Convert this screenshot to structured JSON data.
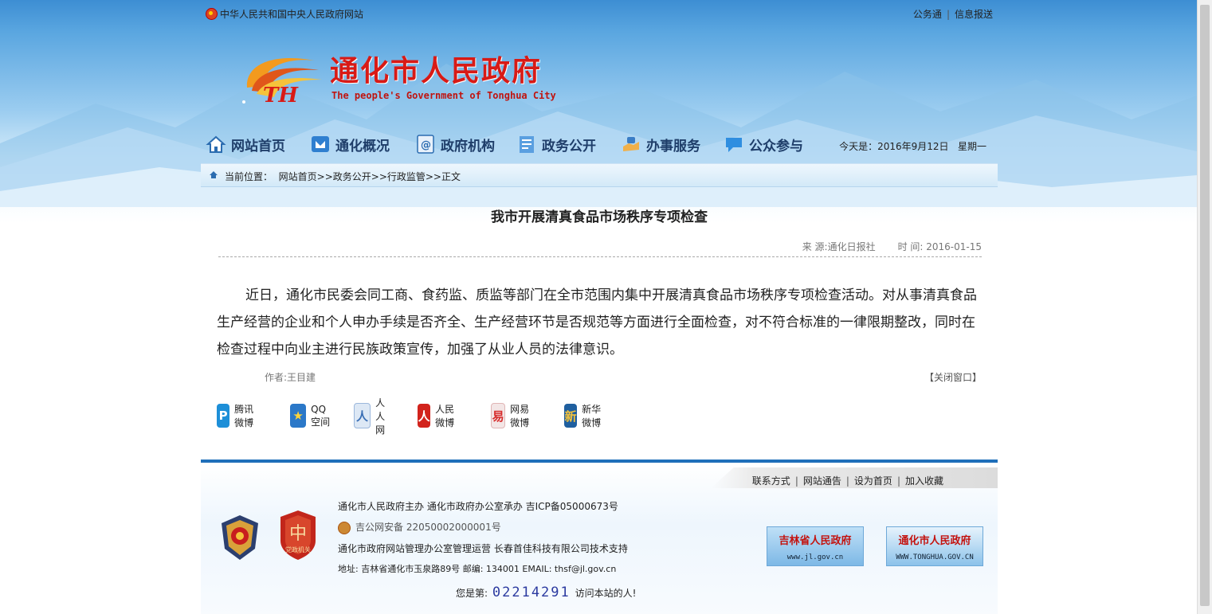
{
  "topbar": {
    "site_link": "中华人民共和国中央人民政府网站",
    "right_links": [
      "公务通",
      "信息报送"
    ]
  },
  "logo": {
    "cn": "通化市人民政府",
    "en": "The people's Government of Tonghua City",
    "mark_letters": "TH"
  },
  "nav": {
    "items": [
      {
        "label": "网站首页",
        "icon": "home-icon"
      },
      {
        "label": "通化概况",
        "icon": "overview-icon"
      },
      {
        "label": "政府机构",
        "icon": "institution-icon"
      },
      {
        "label": "政务公开",
        "icon": "document-icon"
      },
      {
        "label": "办事服务",
        "icon": "service-icon"
      },
      {
        "label": "公众参与",
        "icon": "chat-icon"
      }
    ],
    "date": "今天是：2016年9月12日",
    "weekday": "星期一"
  },
  "breadcrumb": {
    "label": "当前位置：",
    "path": "网站首页>>政务公开>>行政监管>>正文"
  },
  "article": {
    "title": "我市开展清真食品市场秩序专项检查",
    "source": "来 源:通化日报社",
    "time": "时 间: 2016-01-15",
    "body": "近日，通化市民委会同工商、食药监、质监等部门在全市范围内集中开展清真食品市场秩序专项检查活动。对从事清真食品生产经营的企业和个人申办手续是否齐全、生产经营环节是否规范等方面进行全面检查，对不符合标准的一律限期整改，同时在检查过程中向业主进行民族政策宣传，加强了从业人员的法律意识。",
    "author": "作者:王目建",
    "close": "【关闭窗口】"
  },
  "share": [
    {
      "label": "腾讯微博",
      "icon": "tencent-weibo-icon",
      "color": "#1d8fd8",
      "glyph": "P"
    },
    {
      "label": "QQ空间",
      "icon": "qzone-icon",
      "color": "#2b78c8",
      "glyph": "★"
    },
    {
      "label": "人人网",
      "icon": "renren-icon",
      "color": "#3a6fb5",
      "glyph": "人"
    },
    {
      "label": "人民微博",
      "icon": "people-weibo-icon",
      "color": "#d2231c",
      "glyph": "人"
    },
    {
      "label": "网易微博",
      "icon": "netease-weibo-icon",
      "color": "#d72c2c",
      "glyph": "易"
    },
    {
      "label": "新华微博",
      "icon": "xinhua-weibo-icon",
      "color": "#1f5f9f",
      "glyph": "新"
    }
  ],
  "footer": {
    "links": [
      "联系方式",
      "网站通告",
      "设为首页",
      "加入收藏"
    ],
    "host": "通化市人民政府主办 通化市政府办公室承办 吉ICP备05000673号",
    "police": "吉公网安备 22050002000001号",
    "operator": "通化市政府网站管理办公室管理运营 长春首佳科技有限公司技术支持",
    "address": "地址: 吉林省通化市玉泉路89号 邮编: 134001 EMAIL: thsf@jl.gov.cn",
    "counter_prefix": "您是第:",
    "counter_num": "02214291",
    "counter_suffix": "访问本站的人!",
    "banner1_title": "吉林省人民政府",
    "banner1_url": "www.jl.gov.cn",
    "banner2_title": "通化市人民政府",
    "banner2_url": "WWW.TONGHUA.GOV.CN",
    "badge2_text": "党政机关"
  },
  "colors": {
    "accent_blue": "#1f6fba",
    "logo_red": "#d81a16",
    "nav_text": "#1f3e6a"
  }
}
